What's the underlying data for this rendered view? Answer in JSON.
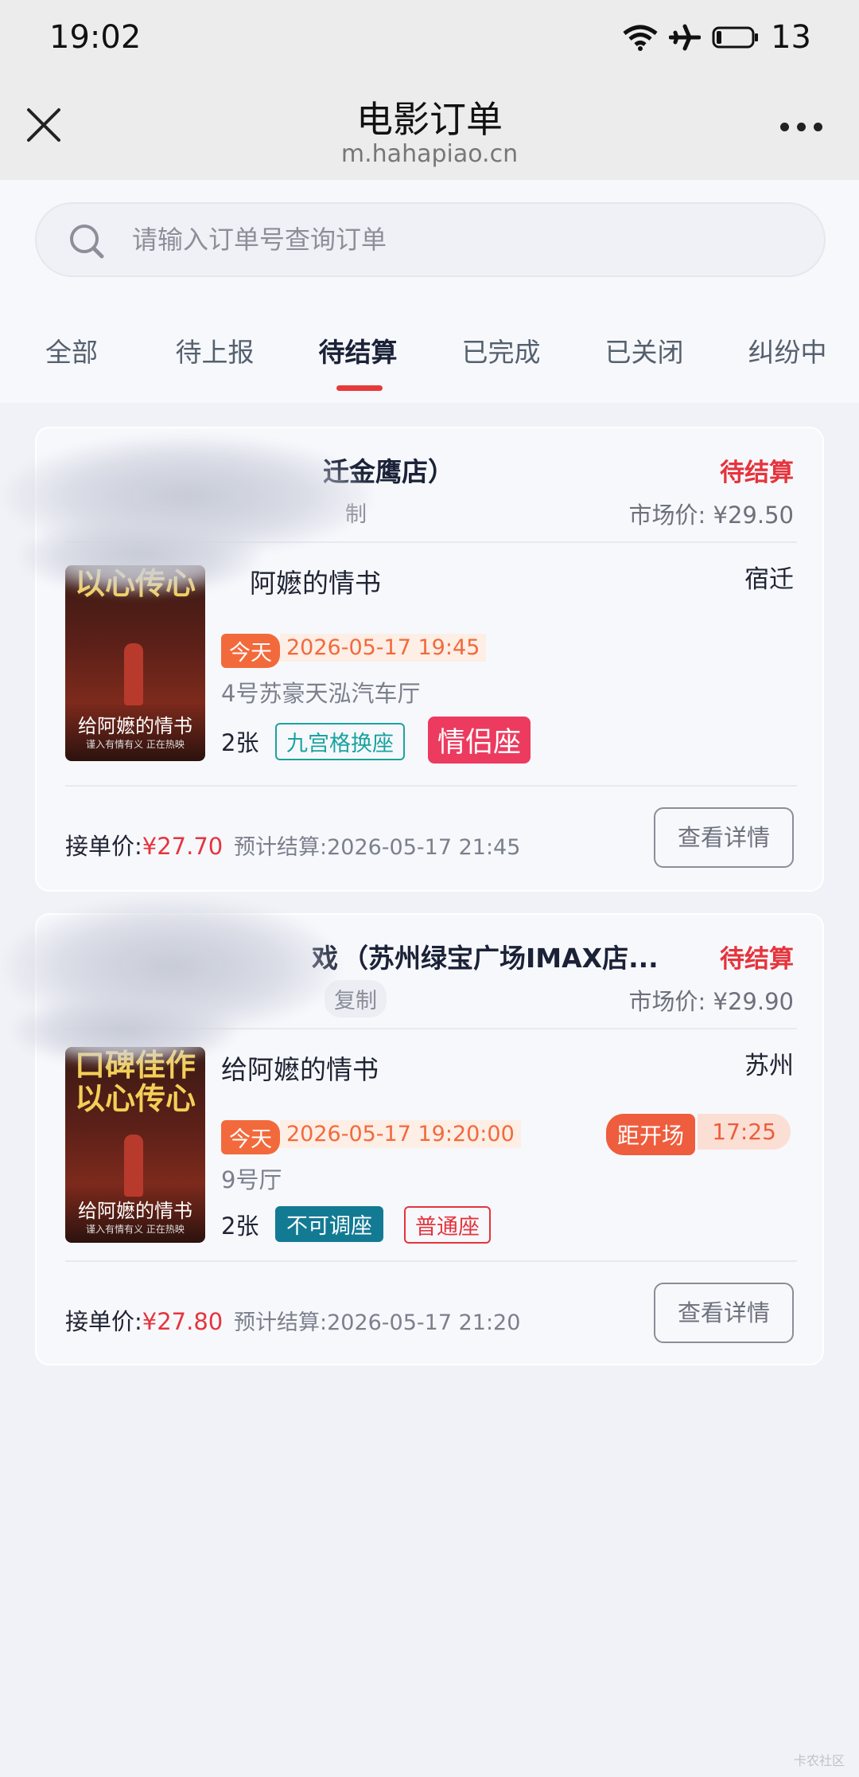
{
  "status_bar": {
    "time": "19:02",
    "battery": "13"
  },
  "nav": {
    "title": "电影订单",
    "url": "m.hahapiao.cn"
  },
  "search": {
    "placeholder": "请输入订单号查询订单"
  },
  "tabs": [
    {
      "label": "全部"
    },
    {
      "label": "待上报"
    },
    {
      "label": "待结算",
      "active": true
    },
    {
      "label": "已完成"
    },
    {
      "label": "已关闭"
    },
    {
      "label": "纠纷中"
    }
  ],
  "orders": [
    {
      "cinema": "迁金鹰店）",
      "status": "待结算",
      "copy": "制",
      "market_price": "市场价: ¥29.50",
      "movie": "给阿嬷的情书",
      "movie_visible": "阿嬷的情书",
      "city": "宿迁",
      "today": "今天",
      "datetime": "2026-05-17 19:45",
      "hall": "4号苏豪天泓汽车厅",
      "tickets": "2张",
      "tag1": "九宫格换座",
      "tag2": "情侣座",
      "price_label": "接单价:",
      "price": "¥27.70",
      "settle": "预计结算:2026-05-17 21:45",
      "detail_btn": "查看详情",
      "poster": {
        "top": "以心传心",
        "title": "给阿嬷的情书",
        "sub": "谨入有情有义 正在热映"
      }
    },
    {
      "cinema": "（苏州绿宝广场IMAX店...",
      "cinema_prefix": "戏",
      "status": "待结算",
      "copy": "复制",
      "market_price": "市场价: ¥29.90",
      "movie": "给阿嬷的情书",
      "city": "苏州",
      "today": "今天",
      "datetime": "2026-05-17 19:20:00",
      "countdown_label": "距开场",
      "countdown_time": "17:25",
      "hall": "9号厅",
      "tickets": "2张",
      "tag1": "不可调座",
      "tag2": "普通座",
      "price_label": "接单价:",
      "price": "¥27.80",
      "settle": "预计结算:2026-05-17 21:20",
      "detail_btn": "查看详情",
      "poster": {
        "top1": "口碑佳作",
        "top2": "以心传心",
        "title": "给阿嬷的情书",
        "sub": "谨入有情有义 正在热映"
      }
    }
  ],
  "watermark": "卡农社区"
}
